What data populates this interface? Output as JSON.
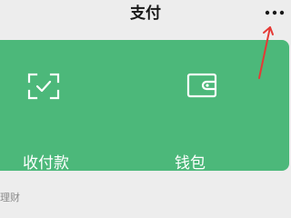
{
  "header": {
    "title": "支付",
    "more_icon": "more-dots-icon"
  },
  "services": [
    {
      "label": "收付款",
      "icon": "scan-check-icon"
    },
    {
      "label": "钱包",
      "icon": "wallet-icon"
    }
  ],
  "section": {
    "label": "理财"
  },
  "colors": {
    "card": "#4cb87a",
    "background": "#ededed",
    "annotation": "#e53935"
  }
}
